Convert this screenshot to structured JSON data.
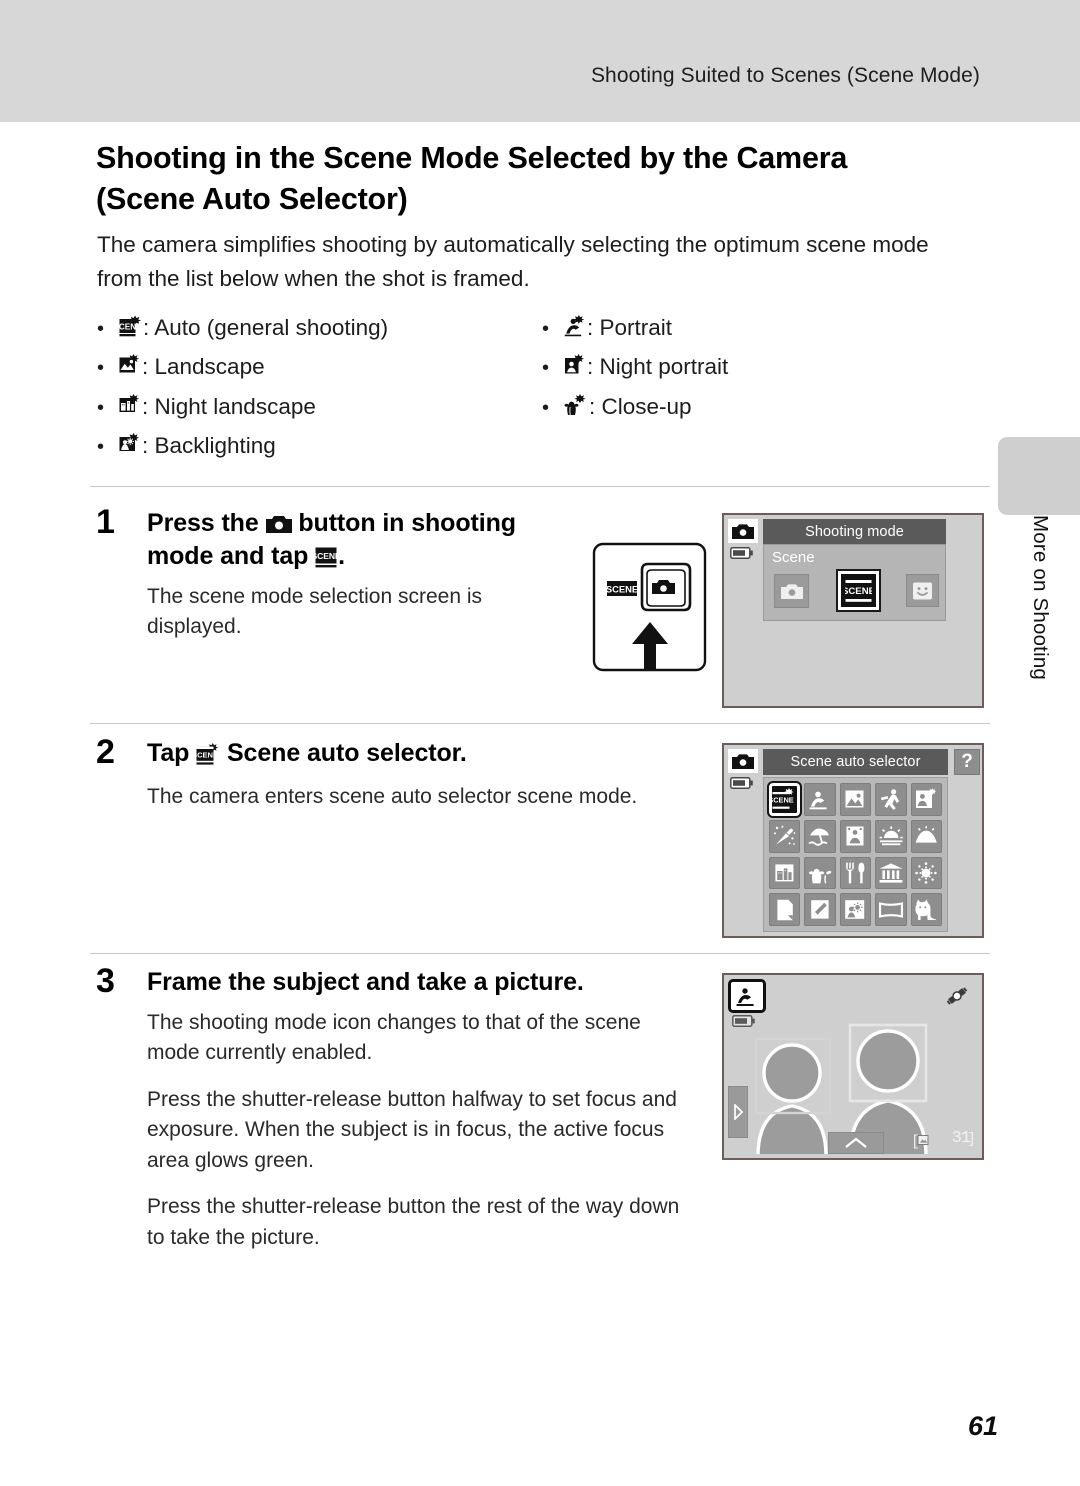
{
  "header": {
    "running_title": "Shooting Suited to Scenes (Scene Mode)"
  },
  "title": "Shooting in the Scene Mode Selected by the Camera (Scene Auto Selector)",
  "intro": "The camera simplifies shooting by automatically selecting the optimum scene mode from the list below when the shot is framed.",
  "scene_list": {
    "left_column": [
      {
        "icon": "scene-auto-selector-icon",
        "label": ": Auto (general shooting)"
      },
      {
        "icon": "landscape-icon",
        "label": ": Landscape"
      },
      {
        "icon": "night-landscape-icon",
        "label": ": Night landscape"
      },
      {
        "icon": "backlighting-icon",
        "label": ": Backlighting"
      }
    ],
    "right_column": [
      {
        "icon": "portrait-icon",
        "label": ": Portrait"
      },
      {
        "icon": "night-portrait-icon",
        "label": ": Night portrait"
      },
      {
        "icon": "close-up-icon",
        "label": ": Close-up"
      }
    ]
  },
  "steps": [
    {
      "number": "1",
      "heading_part1": "Press the ",
      "heading_icon": "camera-mode-button-icon",
      "heading_part2": " button in shooting mode and tap ",
      "heading_icon2": "scene-icon",
      "heading_part3": ".",
      "body": [
        "The scene mode selection screen is displayed."
      ]
    },
    {
      "number": "2",
      "heading_part1": "Tap ",
      "heading_icon": "scene-auto-selector-icon",
      "heading_part2": " Scene auto selector.",
      "body": [
        "The camera enters scene auto selector scene mode."
      ]
    },
    {
      "number": "3",
      "heading_part1": "Frame the subject and take a picture.",
      "body": [
        "The shooting mode icon changes to that of the scene mode currently enabled.",
        "Press the shutter-release button halfway to set focus and exposure. When the subject is in focus, the active focus area glows green.",
        "Press the shutter-release button the rest of the way down to take the picture."
      ]
    }
  ],
  "illustrations": {
    "button_diagram": {
      "scene_label": "SCENE",
      "button_icon": "camera-mode-button-icon",
      "arrow": "up-arrow-icon"
    },
    "screen1": {
      "titlebar": "Shooting mode",
      "sublabel": "Scene",
      "modes": [
        {
          "icon": "auto-mode-icon",
          "selected": false
        },
        {
          "icon": "scene-icon",
          "selected": true
        },
        {
          "icon": "smart-portrait-icon",
          "selected": false
        }
      ],
      "status_icons": [
        "camera-icon",
        "battery-icon"
      ]
    },
    "screen2": {
      "titlebar": "Scene auto selector",
      "help_label": "?",
      "status_icons": [
        "camera-icon",
        "battery-icon"
      ],
      "grid_icons": [
        "scene-auto-selector-icon",
        "portrait-icon",
        "landscape-icon",
        "sports-icon",
        "night-portrait-icon",
        "party-indoor-icon",
        "beach-icon",
        "snow-icon",
        "sunset-icon",
        "dusk-dawn-icon",
        "night-landscape-icon",
        "close-up-icon",
        "food-icon",
        "museum-icon",
        "fireworks-icon",
        "copy-icon",
        "draw-icon",
        "backlighting-icon",
        "panorama-icon",
        "pet-portrait-icon"
      ],
      "selected_index": 0
    },
    "screen3": {
      "mode_badge_icon": "portrait-icon",
      "status_icons": [
        "battery-icon",
        "camera-shake-icon"
      ],
      "left_tab_icon": "right-chevron-icon",
      "bottom_tab_icon": "up-chevron-icon",
      "memory_icon": "memory-card-icon",
      "shots_remaining": "31",
      "subjects": [
        "person-silhouette",
        "person-silhouette"
      ],
      "focus_frames": 2
    }
  },
  "side_tab": {
    "label": "More on Shooting"
  },
  "page_number": "61",
  "colors": {
    "header_band": "#d7d7d7",
    "lcd_background": "#cfcfcf",
    "titlebar": "#5a5a5a",
    "panel": "#b5b5b5",
    "icon_tile": "#8e8e8e",
    "rule": "#c9c9c9"
  }
}
